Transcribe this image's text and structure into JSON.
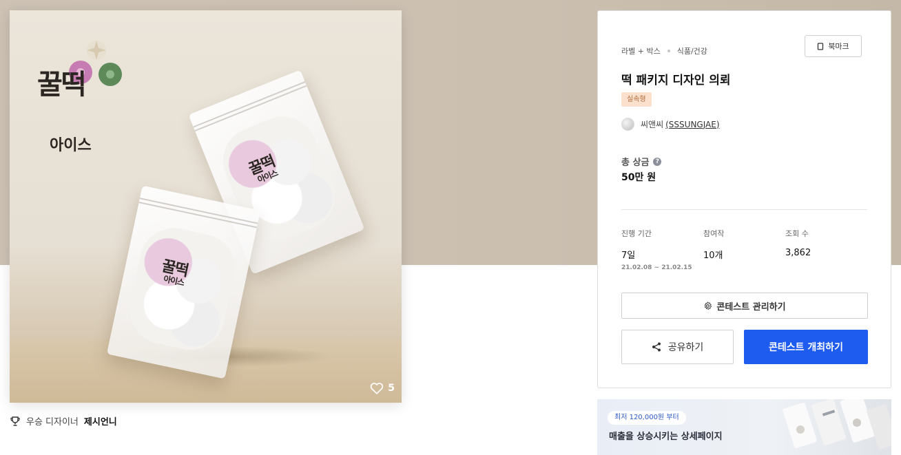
{
  "artwork": {
    "brand_name": "꿀떡",
    "brand_sub": "아이스",
    "likes": "5"
  },
  "award": {
    "prefix": "우승 디자이너",
    "designer": "제시언니"
  },
  "panel": {
    "category": "라벨 + 박스",
    "subcategory": "식품/건강",
    "bookmark_label": "북마크",
    "title": "떡 패키지 디자인 의뢰",
    "type_badge": "실속형",
    "creator_name": "씨앤씨",
    "creator_id": "(SSSUNGJAE)",
    "prize_label": "총 상금",
    "prize_help": "?",
    "prize_value": "50만 원",
    "stats": [
      {
        "label": "진행 기간",
        "value": "7일",
        "sub": "21.02.08 ~ 21.02.15"
      },
      {
        "label": "참여작",
        "value": "10개"
      },
      {
        "label": "조회 수",
        "value": "3,862"
      }
    ],
    "manage_label": "콘테스트 관리하기",
    "share_label": "공유하기",
    "host_label": "콘테스트 개최하기"
  },
  "promo": {
    "pill": "최저 120,000원 부터",
    "title": "매출을 상승시키는 상세페이지"
  },
  "colors": {
    "primary": "#1e5cf0",
    "badge_bg": "#fbe1cd",
    "badge_text": "#b26a3a",
    "hero_bg": "#cdc2b4"
  }
}
